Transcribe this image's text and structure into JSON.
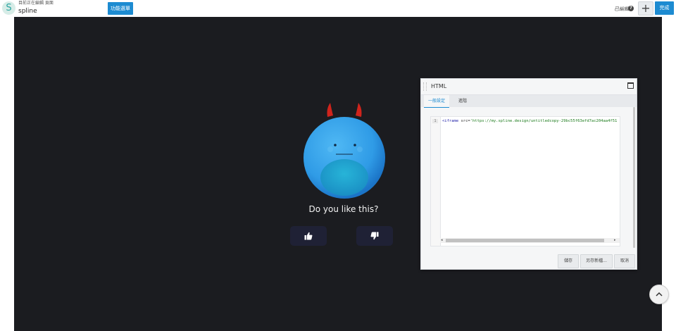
{
  "header": {
    "logo_letter": "S",
    "editing_label": "目前正在編輯 頁面",
    "page_name": "spline",
    "menu_button": "功能選單",
    "saved_status": "已編輯",
    "help_icon": "?",
    "add_icon": "+",
    "done_button": "完成"
  },
  "canvas": {
    "background": "#1b1c20",
    "question": "Do you like this?",
    "like_icon": "thumbs-up-icon",
    "dislike_icon": "thumbs-down-icon",
    "creature_color": "#2f9be6",
    "horn_color": "#d0241c",
    "button_color": "#1f2135"
  },
  "modal": {
    "title": "HTML",
    "tabs": [
      "一般設定",
      "進階"
    ],
    "active_tab": "一般設定",
    "line_number": "1",
    "code": {
      "tag": "<iframe",
      "attr": " src=",
      "value": "'https://my.spline.design/untitledcopy-29bc55f63efd7ac204aa4f51"
    },
    "buttons": {
      "save": "儲存",
      "save_as": "另存新檔...",
      "cancel": "取消"
    }
  },
  "accent_color": "#1d8bd1"
}
